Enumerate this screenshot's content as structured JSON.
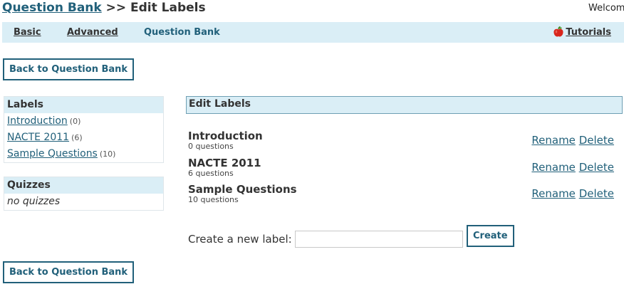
{
  "header": {
    "breadcrumb_link": "Question Bank",
    "breadcrumb_rest": " >> Edit Labels",
    "welcome": "Welcom"
  },
  "nav": {
    "basic": "Basic",
    "advanced": "Advanced",
    "question_bank": "Question Bank",
    "tutorials": "Tutorials"
  },
  "buttons": {
    "back_top": "Back to Question Bank",
    "back_bottom": "Back to Question Bank",
    "create": "Create"
  },
  "sidebar": {
    "labels_title": "Labels",
    "labels": [
      {
        "name": "Introduction",
        "count": "(0)"
      },
      {
        "name": "NACTE 2011",
        "count": "(6)"
      },
      {
        "name": "Sample Questions",
        "count": "(10)"
      }
    ],
    "quizzes_title": "Quizzes",
    "quizzes_empty": "no quizzes"
  },
  "main": {
    "title": "Edit Labels",
    "items": [
      {
        "name": "Introduction",
        "sub": "0 questions",
        "rename": "Rename",
        "delete": "Delete"
      },
      {
        "name": "NACTE 2011",
        "sub": "6 questions",
        "rename": "Rename",
        "delete": "Delete"
      },
      {
        "name": "Sample Questions",
        "sub": "10 questions",
        "rename": "Rename",
        "delete": "Delete"
      }
    ],
    "create_label": "Create a new label:",
    "create_value": ""
  },
  "colors": {
    "accent": "#21607a",
    "nav_bg": "#daeef6"
  }
}
